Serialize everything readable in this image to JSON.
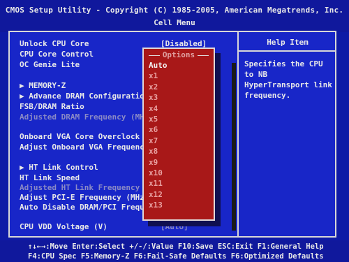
{
  "header": {
    "title": "CMOS Setup Utility - Copyright (C) 1985-2005, American Megatrends, Inc.",
    "subtitle": "Cell Menu"
  },
  "help": {
    "title": "Help Item",
    "text": "Specifies the CPU to NB HyperTransport link frequency."
  },
  "menu": {
    "unlock_cpu_core": "Unlock CPU Core",
    "unlock_cpu_core_value": "[Disabled]",
    "cpu_core_control": "CPU Core Control",
    "oc_genie_lite": "OC Genie Lite",
    "memory_z": "▶ MEMORY-Z",
    "advance_dram": "▶ Advance DRAM Configuration",
    "fsb_dram_ratio": "FSB/DRAM Ratio",
    "adjusted_dram": "Adjusted DRAM Frequency (MHz",
    "onboard_vga": "Onboard VGA Core Overclock",
    "adjust_onboard_vga": "Adjust Onboard VGA Frequency",
    "ht_link_control": "▶ HT Link Control",
    "ht_link_speed": "HT Link Speed",
    "adjusted_ht": "Adjusted HT Link Frequency (",
    "adjust_pcie": "Adjust PCI-E Frequency (MHz)",
    "auto_disable": "Auto Disable DRAM/PCI Freque",
    "cpu_vdd": "CPU VDD Voltage (V)",
    "cpu_vdd_value": "[Auto]"
  },
  "popup": {
    "title": "Options",
    "options": [
      "Auto",
      "x1",
      "x2",
      "x3",
      "x4",
      "x5",
      "x6",
      "x7",
      "x8",
      "x9",
      "x10",
      "x11",
      "x12",
      "x13"
    ],
    "selected_index": 0
  },
  "footer": {
    "line1": "↑↓←→:Move  Enter:Select  +/-/:Value  F10:Save  ESC:Exit  F1:General Help",
    "line2": "F4:CPU Spec  F5:Memory-Z  F6:Fail-Safe Defaults   F6:Optimized Defaults"
  },
  "colors": {
    "background": "#1826c8",
    "popup": "#a81818",
    "text": "#e8e8e8",
    "disabled_text": "#8a8ac6"
  }
}
